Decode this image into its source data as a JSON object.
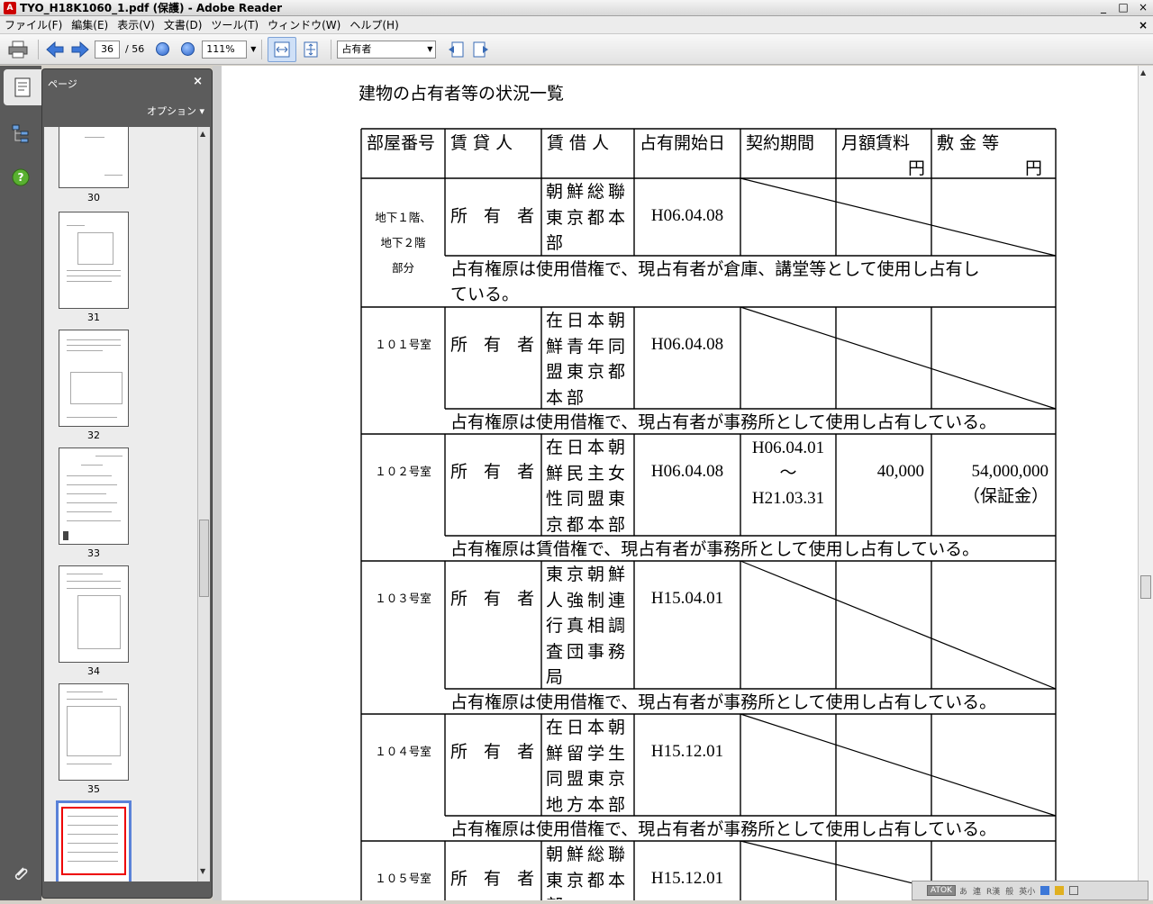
{
  "window": {
    "title": "TYO_H18K1060_1.pdf (保護) - Adobe Reader",
    "min": "_",
    "max": "□",
    "close": "×"
  },
  "menu": {
    "items": [
      "ファイル(F)",
      "編集(E)",
      "表示(V)",
      "文書(D)",
      "ツール(T)",
      "ウィンドウ(W)",
      "ヘルプ(H)"
    ],
    "close_doc": "×"
  },
  "toolbar": {
    "page_current": "36",
    "page_total": "/ 56",
    "zoom": "111%",
    "search": "占有者"
  },
  "panel": {
    "title": "ページ",
    "close": "×",
    "options": "オプション ▾",
    "thumb_labels": [
      "30",
      "31",
      "32",
      "33",
      "34",
      "35"
    ]
  },
  "document": {
    "title": "建物の占有者等の状況一覧",
    "headers": [
      "部屋番号",
      "賃 貸 人",
      "賃 借 人",
      "占有開始日",
      "契約期間",
      "月額賃料",
      "円",
      "敷 金 等",
      "円"
    ],
    "rows": [
      {
        "room": "地下１階、\n地下２階\n部分",
        "lessor": "所 有 者",
        "lessee": "朝鮮総聯東京都本部",
        "start": "H06.04.08",
        "term": "",
        "rent": "",
        "deposit": "",
        "note": "占有権原は使用借権で、現占有者が倉庫、講堂等として使用し占有し\nている。"
      },
      {
        "room": "１０１号室",
        "lessor": "所 有 者",
        "lessee": "在日本朝鮮青年同盟東京都本部",
        "start": "H06.04.08",
        "term": "",
        "rent": "",
        "deposit": "",
        "note": "占有権原は使用借権で、現占有者が事務所として使用し占有している。"
      },
      {
        "room": "１０２号室",
        "lessor": "所 有 者",
        "lessee": "在日本朝鮮民主女性同盟東京都本部",
        "start": "H06.04.08",
        "term": "H06.04.01\n～\nH21.03.31",
        "rent": "40,000",
        "deposit": "54,000,000\n（保証金）",
        "note": "占有権原は賃借権で、現占有者が事務所として使用し占有している。"
      },
      {
        "room": "１０３号室",
        "lessor": "所 有 者",
        "lessee": "東京朝鮮人強制連行真相調査団事務局",
        "start": "H15.04.01",
        "term": "",
        "rent": "",
        "deposit": "",
        "note": "占有権原は使用借権で、現占有者が事務所として使用し占有している。"
      },
      {
        "room": "１０４号室",
        "lessor": "所 有 者",
        "lessee": "在日本朝鮮留学生同盟東京地方本部",
        "start": "H15.12.01",
        "term": "",
        "rent": "",
        "deposit": "",
        "note": "占有権原は使用借権で、現占有者が事務所として使用し占有している。"
      },
      {
        "room": "１０５号室",
        "lessor": "所 有 者",
        "lessee": "朝鮮総聯東京都本部",
        "start": "H15.12.01",
        "term": "",
        "rent": "",
        "deposit": "",
        "note": ""
      }
    ]
  },
  "ime": {
    "atok": "ATOK",
    "items": [
      "あ",
      "連",
      "R漢",
      "般",
      "英小"
    ]
  }
}
